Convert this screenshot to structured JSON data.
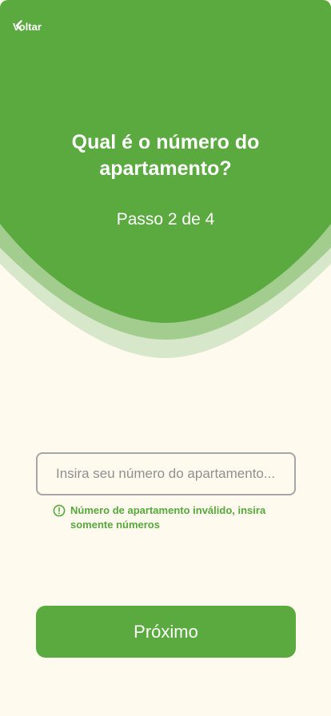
{
  "colors": {
    "primary": "#5aaa40",
    "wave_mid": "#a3cd8e",
    "wave_light": "#d6e8c9",
    "background": "#fff9ee",
    "error": "#56a93b",
    "input_border": "#a6a6a6"
  },
  "header": {
    "back_label": "Voltar",
    "back_icon": "chevron-left-icon"
  },
  "hero": {
    "title": "Qual é o número do apartamento?",
    "step": "Passo 2 de 4"
  },
  "form": {
    "apartment_input": {
      "placeholder": "Insira seu número do apartamento...",
      "value": ""
    },
    "error": {
      "icon": "alert-circle-icon",
      "message": "Número de apartamento inválido, insira somente números"
    }
  },
  "actions": {
    "next_label": "Próximo"
  }
}
